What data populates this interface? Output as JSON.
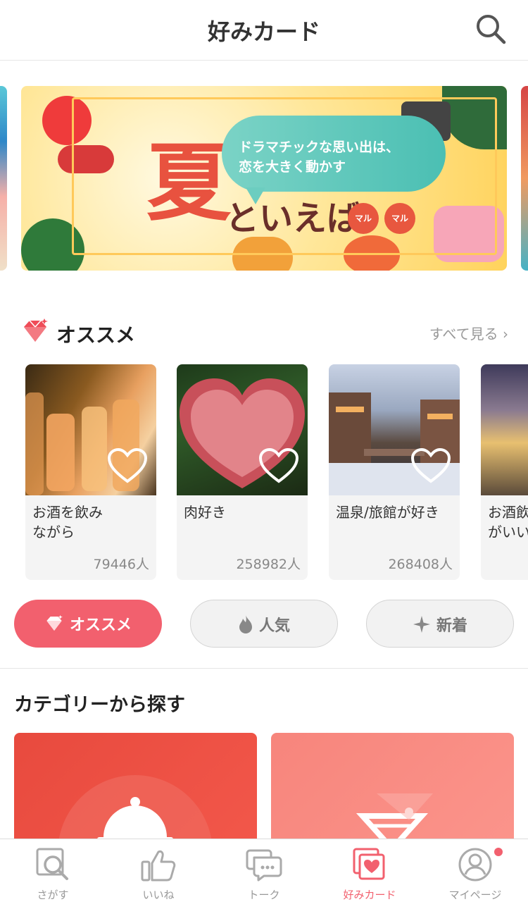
{
  "header": {
    "title": "好みカード"
  },
  "banner": {
    "kanji": "夏",
    "subtitle": "といえば",
    "bubble_line1": "ドラマチックな思い出は、",
    "bubble_line2": "恋を大きく動かす",
    "maru1": "マル",
    "maru2": "マル"
  },
  "recommend": {
    "title": "オススメ",
    "see_all": "すべて見る",
    "cards": [
      {
        "title": "お酒を飲み\nながら",
        "count": "79446人"
      },
      {
        "title": "肉好き",
        "count": "258982人"
      },
      {
        "title": "温泉/旅館が好き",
        "count": "268408人"
      },
      {
        "title": "お酒飲\nがいい",
        "count": ""
      }
    ]
  },
  "filters": {
    "recommend": "オススメ",
    "popular": "人気",
    "new": "新着"
  },
  "category": {
    "title": "カテゴリーから探す"
  },
  "tabbar": {
    "search": "さがす",
    "likes": "いいね",
    "talk": "トーク",
    "cards": "好みカード",
    "mypage": "マイページ"
  },
  "colors": {
    "accent": "#f2606e",
    "tab_inactive": "#999999"
  }
}
